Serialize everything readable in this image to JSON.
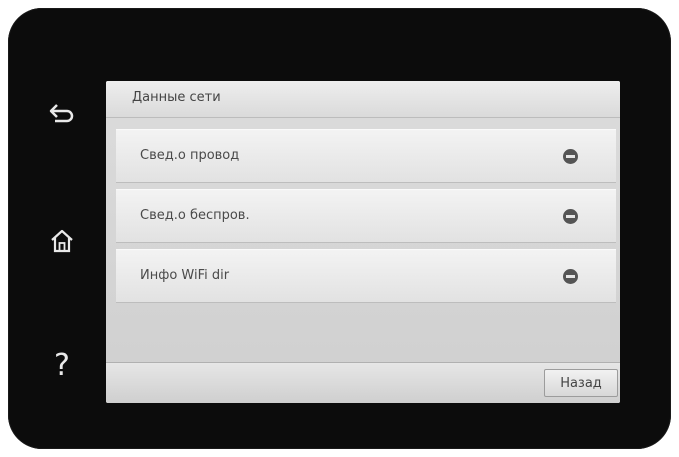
{
  "side_buttons": [
    {
      "icon": "back-arrow-icon"
    },
    {
      "icon": "home-icon"
    },
    {
      "icon": "help-icon",
      "glyph": "?"
    }
  ],
  "screen": {
    "title": "Данные сети",
    "items": [
      {
        "label": "Свед.о провод",
        "icon": "minus-icon"
      },
      {
        "label": "Свед.о беспров.",
        "icon": "minus-icon"
      },
      {
        "label": "Инфо WiFi dir",
        "icon": "minus-icon"
      }
    ],
    "back_label": "Назад"
  },
  "colors": {
    "bezel": "#0c0c0c",
    "screen_bg": "#d4d4d4",
    "item_bg": "#ebebeb",
    "text": "#444444",
    "icon": "#555555"
  }
}
